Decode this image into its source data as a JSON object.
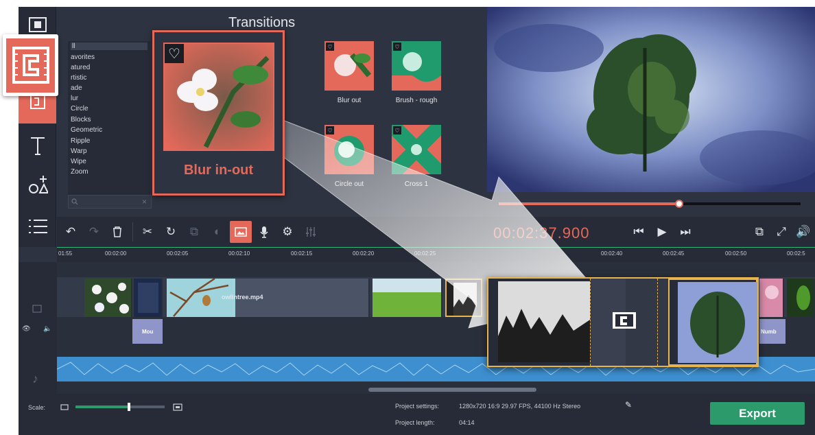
{
  "panel": {
    "title": "Transitions"
  },
  "categories": [
    "All",
    "Favorites",
    "Featured",
    "Artistic",
    "Fade",
    "Blur",
    "Circle",
    "Blocks",
    "Geometric",
    "Ripple",
    "Warp",
    "Wipe",
    "Zoom"
  ],
  "category_display": [
    "ll",
    "avorites",
    "atured",
    "rtistic",
    "ade",
    "lur",
    "Circle",
    "Blocks",
    "Geometric",
    "Ripple",
    "Warp",
    "Wipe",
    "Zoom"
  ],
  "selected_category": "All",
  "transitions": [
    {
      "label": "Blur out"
    },
    {
      "label": "Brush - rough"
    },
    {
      "label": "Circle out"
    },
    {
      "label": "Cross 1"
    }
  ],
  "featured_transition": {
    "label": "Blur in-out"
  },
  "player": {
    "timecode": "00:02:37.900",
    "position": 0.6
  },
  "ruler_ticks": [
    "01:55",
    "00:02:00",
    "00:02:05",
    "00:02:10",
    "00:02:15",
    "00:02:20",
    "00:02:25",
    "00:02:40",
    "00:02:45",
    "00:02:50",
    "00:02:5"
  ],
  "clips": {
    "video_label": "owlintree.mp4",
    "audio_label_1": "Mou",
    "audio_label_2": "Numb"
  },
  "footer": {
    "scale_label": "Scale:",
    "scale_value": 0.6,
    "settings_label": "Project settings:",
    "settings_value": "1280x720 16:9 29.97 FPS, 44100 Hz Stereo",
    "length_label": "Project length:",
    "length_value": "04:14",
    "export_label": "Export"
  },
  "colors": {
    "accent": "#e5695a",
    "export": "#2d9a6c",
    "audio": "#3d8fd0",
    "highlight": "#e8b44d"
  }
}
